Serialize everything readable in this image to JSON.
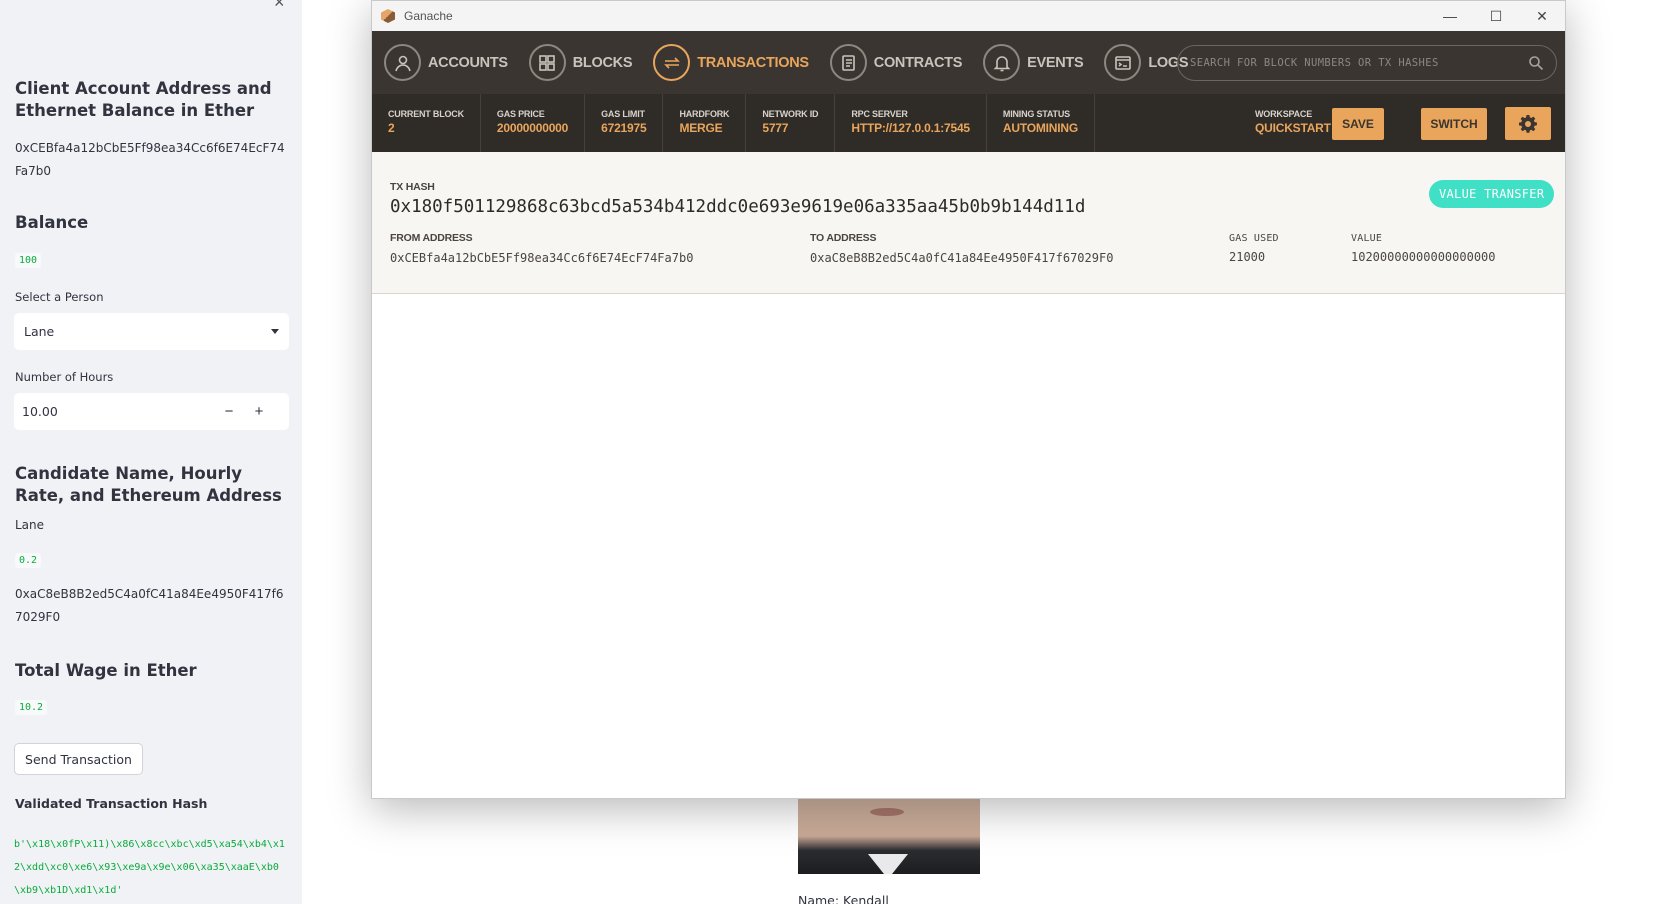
{
  "sidebar": {
    "close_glyph": "×",
    "client_heading": "Client Account Address and Ethernet Balance in Ether",
    "client_address": "0xCEBfa4a12bCbE5Ff98ea34Cc6f6E74EcF74Fa7b0",
    "balance_heading": "Balance",
    "balance_value": "100",
    "select_label": "Select a Person",
    "select_value": "Lane",
    "hours_label": "Number of Hours",
    "hours_value": "10.00",
    "minus": "−",
    "plus": "+",
    "candidate_heading": "Candidate Name, Hourly Rate, and Ethereum Address",
    "candidate_name": "Lane",
    "candidate_rate": "0.2",
    "candidate_address": "0xaC8eB8B2ed5C4a0fC41a84Ee4950F417f67029F0",
    "wage_heading": "Total Wage in Ether",
    "wage_value": "10.2",
    "send_button": "Send Transaction",
    "validated_label": "Validated Transaction Hash",
    "validated_hash": "b'\\x18\\x0fP\\x11)\\x86\\x8cc\\xbc\\xd5\\xa54\\xb4\\x12\\xdd\\xc0\\xe6\\x93\\xe9a\\x9e\\x06\\xa35\\xaaE\\xb0\\xb9\\xb1D\\xd1\\x1d'"
  },
  "main": {
    "name_caption": "Name: Kendall"
  },
  "ganache": {
    "title": "Ganache",
    "window_controls": {
      "minimize": "—",
      "maximize": "☐",
      "close": "✕"
    },
    "nav": [
      {
        "label": "ACCOUNTS",
        "icon": "accounts-icon"
      },
      {
        "label": "BLOCKS",
        "icon": "blocks-icon"
      },
      {
        "label": "TRANSACTIONS",
        "icon": "transactions-icon",
        "active": true
      },
      {
        "label": "CONTRACTS",
        "icon": "contracts-icon"
      },
      {
        "label": "EVENTS",
        "icon": "events-icon"
      },
      {
        "label": "LOGS",
        "icon": "logs-icon"
      }
    ],
    "search_placeholder": "SEARCH FOR BLOCK NUMBERS OR TX HASHES",
    "status": {
      "current_block": {
        "label": "CURRENT BLOCK",
        "value": "2"
      },
      "gas_price": {
        "label": "GAS PRICE",
        "value": "20000000000"
      },
      "gas_limit": {
        "label": "GAS LIMIT",
        "value": "6721975"
      },
      "hardfork": {
        "label": "HARDFORK",
        "value": "MERGE"
      },
      "network_id": {
        "label": "NETWORK ID",
        "value": "5777"
      },
      "rpc_server": {
        "label": "RPC SERVER",
        "value": "HTTP://127.0.0.1:7545"
      },
      "mining_status": {
        "label": "MINING STATUS",
        "value": "AUTOMINING"
      },
      "workspace": {
        "label": "WORKSPACE",
        "value": "QUICKSTART"
      }
    },
    "buttons": {
      "save": "SAVE",
      "switch": "SWITCH"
    },
    "tx": {
      "hash_label": "TX HASH",
      "hash": "0x180f501129868c63bcd5a534b412ddc0e693e9619e06a335aa45b0b9b144d11d",
      "badge": "VALUE TRANSFER",
      "from_label": "FROM ADDRESS",
      "from": "0xCEBfa4a12bCbE5Ff98ea34Cc6f6E74EcF74Fa7b0",
      "to_label": "TO ADDRESS",
      "to": "0xaC8eB8B2ed5C4a0fC41a84Ee4950F417f67029F0",
      "gas_used_label": "GAS USED",
      "gas_used": "21000",
      "value_label": "VALUE",
      "value": "10200000000000000000"
    },
    "colors": {
      "accent": "#e9a55c",
      "nav_bg": "#3a3531",
      "status_bg": "#2f2b27",
      "badge": "#3fe0c5"
    }
  }
}
